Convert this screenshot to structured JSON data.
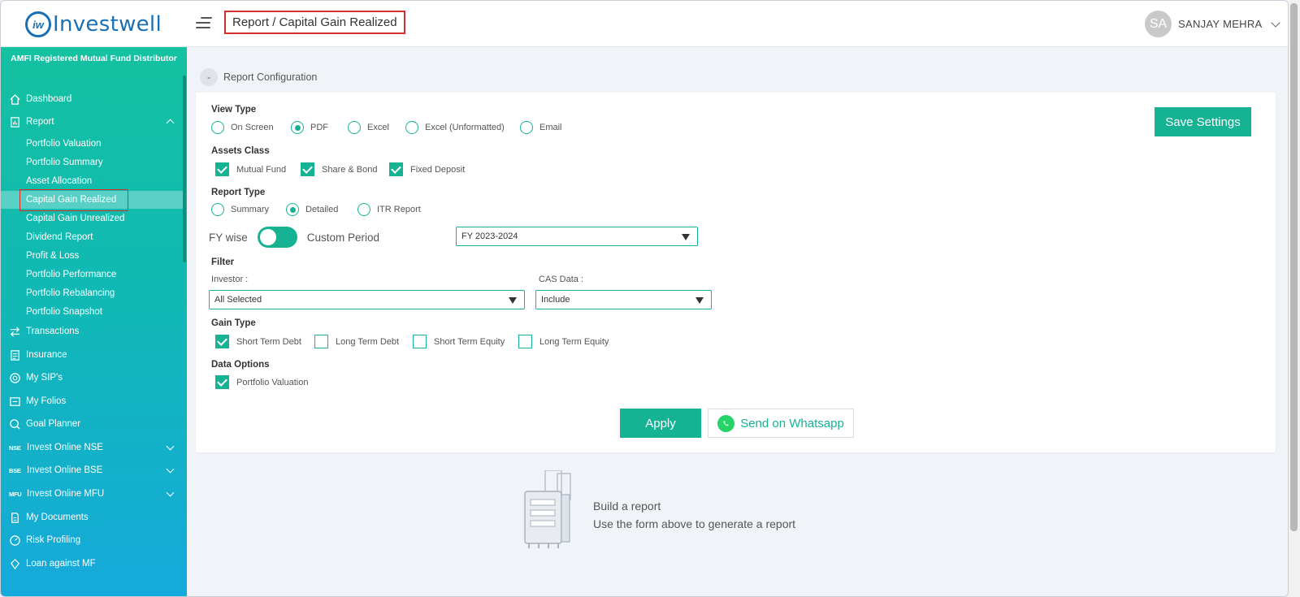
{
  "header": {
    "logo_text": "Investwell",
    "logo_mark": "iw",
    "breadcrumb": "Report / Capital Gain Realized",
    "user_initials": "SA",
    "user_name": "SANJAY MEHRA"
  },
  "sidebar": {
    "tagline": "AMFI Registered Mutual Fund Distributor",
    "items": [
      {
        "label": "Dashboard",
        "icon": "home-icon"
      },
      {
        "label": "Report",
        "icon": "report-icon",
        "expanded": true
      },
      {
        "label": "Transactions",
        "icon": "transfer-icon"
      },
      {
        "label": "Insurance",
        "icon": "insurance-icon"
      },
      {
        "label": "My SIP's",
        "icon": "sip-icon"
      },
      {
        "label": "My Folios",
        "icon": "folio-icon"
      },
      {
        "label": "Goal Planner",
        "icon": "goal-icon"
      },
      {
        "label": "Invest Online NSE",
        "badge": "NSE"
      },
      {
        "label": "Invest Online BSE",
        "badge": "BSE"
      },
      {
        "label": "Invest Online MFU",
        "badge": "MFU"
      },
      {
        "label": "My Documents",
        "icon": "document-icon"
      },
      {
        "label": "Risk Profiling",
        "icon": "risk-icon"
      },
      {
        "label": "Loan against MF",
        "icon": "loan-icon"
      }
    ],
    "report_subitems": [
      "Portfolio Valuation",
      "Portfolio Summary",
      "Asset Allocation",
      "Capital Gain Realized",
      "Capital Gain Unrealized",
      "Dividend Report",
      "Profit & Loss",
      "Portfolio Performance",
      "Portfolio Rebalancing",
      "Portfolio Snapshot"
    ],
    "active_subitem": "Capital Gain Realized"
  },
  "config": {
    "collapse_symbol": "-",
    "title": "Report Configuration",
    "save_label": "Save Settings",
    "view_type": {
      "label": "View Type",
      "options": [
        "On Screen",
        "PDF",
        "Excel",
        "Excel (Unformatted)",
        "Email"
      ],
      "selected": "PDF"
    },
    "assets_class": {
      "label": "Assets Class",
      "options": [
        "Mutual Fund",
        "Share & Bond",
        "Fixed Deposit"
      ],
      "checked": [
        true,
        true,
        true
      ]
    },
    "report_type": {
      "label": "Report Type",
      "options": [
        "Summary",
        "Detailed",
        "ITR Report"
      ],
      "selected": "Detailed"
    },
    "period": {
      "left_label": "FY wise",
      "right_label": "Custom Period",
      "toggle_on": true,
      "fy_value": "FY 2023-2024"
    },
    "filter": {
      "label": "Filter",
      "investor_label": "Investor :",
      "investor_value": "All Selected",
      "cas_label": "CAS Data :",
      "cas_value": "Include"
    },
    "gain_type": {
      "label": "Gain Type",
      "options": [
        "Short Term Debt",
        "Long Term Debt",
        "Short Term Equity",
        "Long Term Equity"
      ],
      "checked": [
        true,
        false,
        false,
        false
      ]
    },
    "data_options": {
      "label": "Data Options",
      "options": [
        "Portfolio Valuation"
      ],
      "checked": [
        true
      ]
    },
    "apply_label": "Apply",
    "whatsapp_label": "Send on Whatsapp"
  },
  "empty_state": {
    "title": "Build a report",
    "subtitle": "Use the form above to generate a report"
  },
  "colors": {
    "accent": "#15b393",
    "brand": "#1b6fb3",
    "highlight": "#d32f2f"
  }
}
